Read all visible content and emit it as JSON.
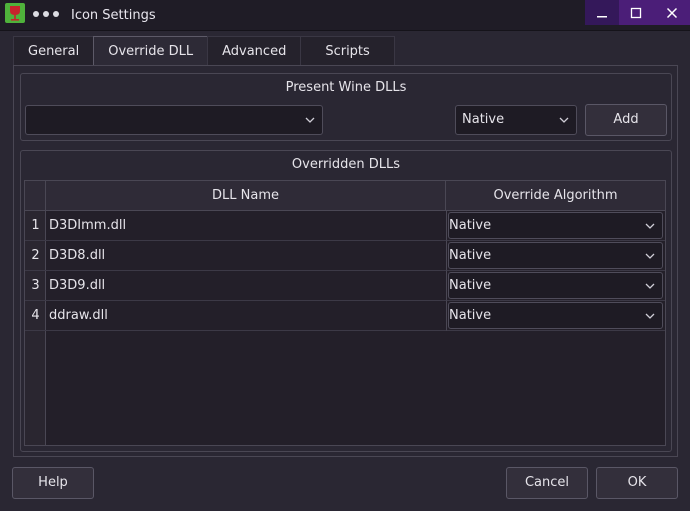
{
  "window": {
    "title": "Icon Settings",
    "buttons": [
      "minimize",
      "maximize",
      "close"
    ]
  },
  "tabs": [
    {
      "label": "General",
      "active": false
    },
    {
      "label": "Override DLL",
      "active": true
    },
    {
      "label": "Advanced",
      "active": false
    },
    {
      "label": "Scripts",
      "active": false
    }
  ],
  "present": {
    "title": "Present Wine DLLs",
    "dll_value": "",
    "mode_value": "Native",
    "add_label": "Add"
  },
  "overridden": {
    "title": "Overridden DLLs",
    "columns": [
      "DLL Name",
      "Override Algorithm"
    ],
    "rows": [
      {
        "num": "1",
        "name": "D3DImm.dll",
        "algo": "Native"
      },
      {
        "num": "2",
        "name": "D3D8.dll",
        "algo": "Native"
      },
      {
        "num": "3",
        "name": "D3D9.dll",
        "algo": "Native"
      },
      {
        "num": "4",
        "name": "ddraw.dll",
        "algo": "Native"
      }
    ]
  },
  "footer": {
    "help": "Help",
    "cancel": "Cancel",
    "ok": "OK"
  },
  "colors": {
    "accent": "#4b1e78",
    "background": "#2a2733",
    "app_icon": "#4fb23b"
  }
}
